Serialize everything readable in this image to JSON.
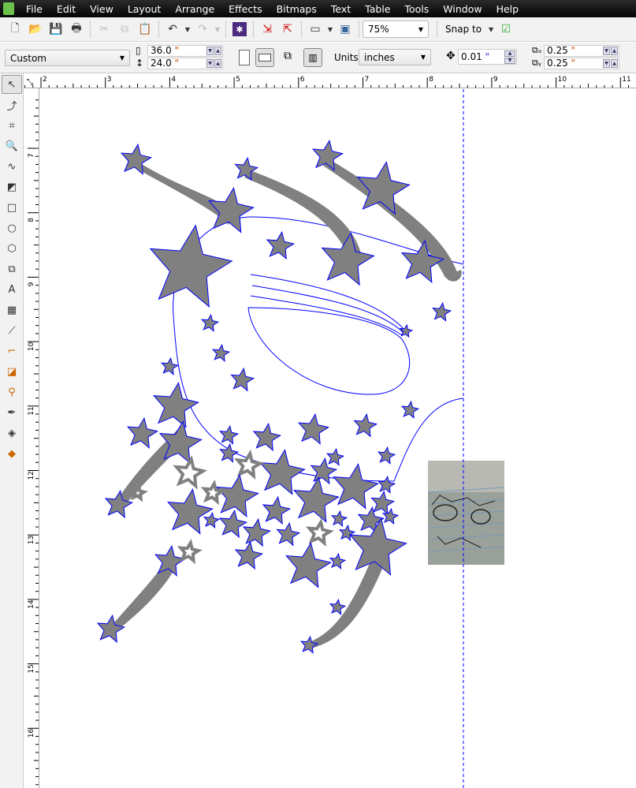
{
  "menu": [
    "File",
    "Edit",
    "View",
    "Layout",
    "Arrange",
    "Effects",
    "Bitmaps",
    "Text",
    "Table",
    "Tools",
    "Window",
    "Help"
  ],
  "toolbar": {
    "zoom": "75%",
    "snap_to": "Snap to"
  },
  "property_bar": {
    "page_size": "Custom",
    "width": "36.0",
    "height": "24.0",
    "units_label": "Units:",
    "units": "inches",
    "nudge": "0.01",
    "dup_x": "0.25",
    "dup_y": "0.25",
    "inch_mark": "\""
  },
  "rulers": {
    "horizontal": [
      "2",
      "3",
      "4",
      "5",
      "6",
      "7",
      "8",
      "9",
      "10",
      "11"
    ],
    "vertical": [
      "7",
      "8",
      "9",
      "10",
      "11",
      "12",
      "13",
      "14",
      "15",
      "16"
    ]
  },
  "colors": {
    "star_fill": "#808080",
    "outline": "#0000ff",
    "menubar": "#111111"
  }
}
